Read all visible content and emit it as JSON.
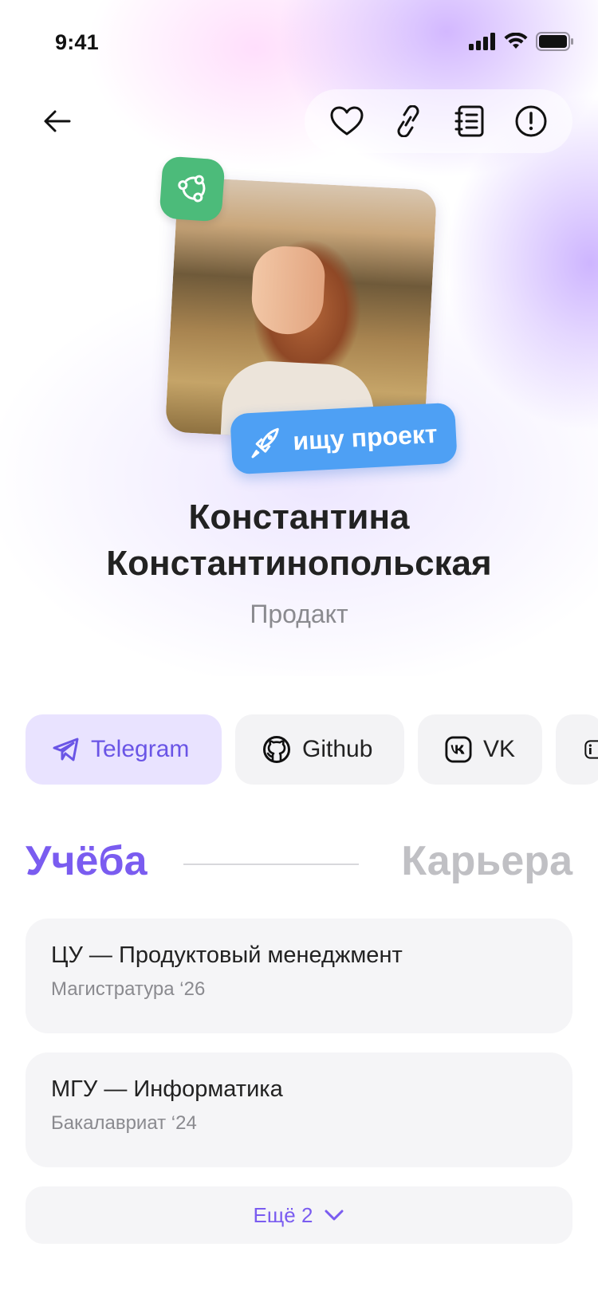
{
  "status_bar": {
    "time": "9:41"
  },
  "profile": {
    "status_badge": "ищу проект",
    "name_line1": "Константина",
    "name_line2": "Константинопольская",
    "role": "Продакт"
  },
  "socials": [
    {
      "label": "Telegram",
      "icon": "telegram-icon"
    },
    {
      "label": "Github",
      "icon": "github-icon"
    },
    {
      "label": "VK",
      "icon": "vk-icon"
    },
    {
      "label": "",
      "icon": "linkedin-icon"
    }
  ],
  "tabs": {
    "active": "Учёба",
    "inactive": "Карьера"
  },
  "education": [
    {
      "title": "ЦУ — Продуктовый менеджмент",
      "subtitle": "Магистратура ‘26"
    },
    {
      "title": "МГУ — Информатика",
      "subtitle": "Бакалавриат ‘24"
    }
  ],
  "more_button": "Ещё 2",
  "colors": {
    "accent": "#7a5cf0",
    "badge_green": "#4cbb7a",
    "badge_blue": "#4ea0f4"
  }
}
